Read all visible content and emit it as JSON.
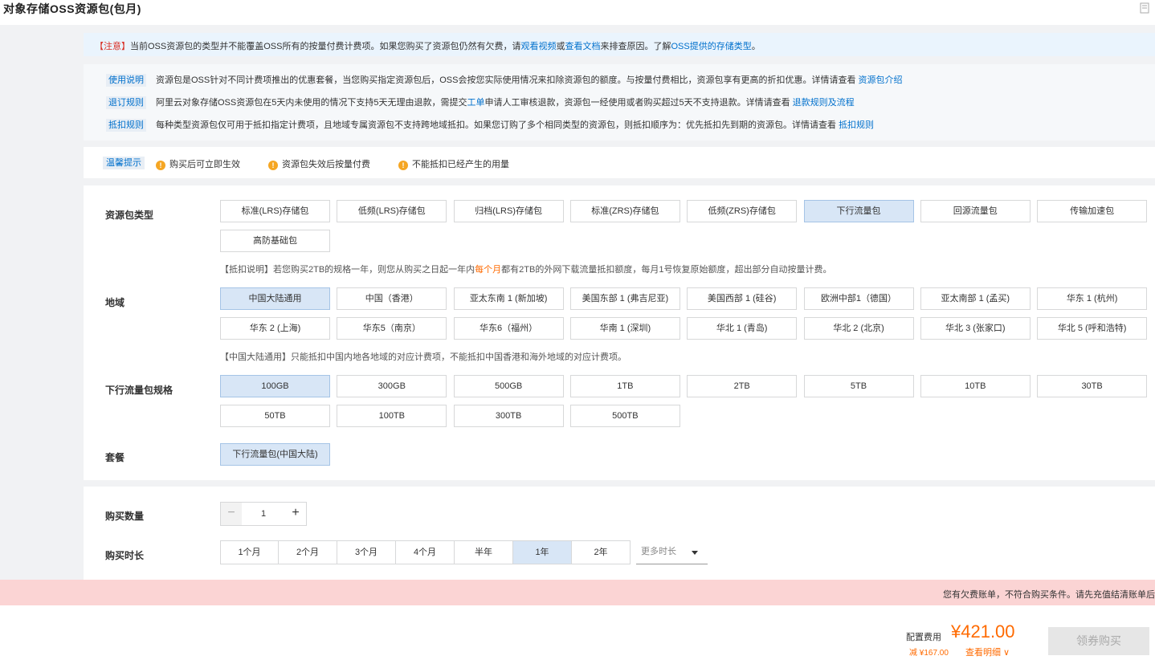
{
  "header": {
    "title": "对象存储OSS资源包(包月)"
  },
  "notice": {
    "tag": "【注意】",
    "text1": "当前OSS资源包的类型并不能覆盖OSS所有的按量付费计费项。如果您购买了资源包仍然有欠费，请",
    "link_video": "观看视频",
    "or": "或",
    "link_doc": "查看文档",
    "text2": "来排查原因。了解",
    "link_types": "OSS提供的存储类型",
    "end": "。"
  },
  "info": {
    "usage": {
      "label": "使用说明",
      "text": "资源包是OSS针对不同计费项推出的优惠套餐，当您购买指定资源包后，OSS会按您实际使用情况来扣除资源包的额度。与按量付费相比，资源包享有更高的折扣优惠。详情请查看 ",
      "link": "资源包介绍"
    },
    "refund": {
      "label": "退订规则",
      "text1": "阿里云对象存储OSS资源包在5天内未使用的情况下支持5天无理由退款，需提交",
      "link1": "工单",
      "text2": "申请人工审核退款，资源包一经使用或者购买超过5天不支持退款。详情请查看 ",
      "link2": "退款规则及流程"
    },
    "deduct": {
      "label": "抵扣规则",
      "text": "每种类型资源包仅可用于抵扣指定计费项，且地域专属资源包不支持跨地域抵扣。如果您订购了多个相同类型的资源包，则抵扣顺序为：优先抵扣先到期的资源包。详情请查看 ",
      "link": "抵扣规则"
    }
  },
  "tips": {
    "label": "温馨提示",
    "items": [
      "购买后可立即生效",
      "资源包失效后按量付费",
      "不能抵扣已经产生的用量"
    ]
  },
  "package_type": {
    "label": "资源包类型",
    "options": [
      "标准(LRS)存储包",
      "低频(LRS)存储包",
      "归档(LRS)存储包",
      "标准(ZRS)存储包",
      "低频(ZRS)存储包",
      "下行流量包",
      "回源流量包",
      "传输加速包",
      "高防基础包"
    ],
    "selected": 5,
    "note_pre": "【抵扣说明】若您购买2TB的规格一年，则您从购买之日起一年内",
    "note_hl": "每个月",
    "note_post": "都有2TB的外网下载流量抵扣额度，每月1号恢复原始额度，超出部分自动按量计费。"
  },
  "region": {
    "label": "地域",
    "options": [
      "中国大陆通用",
      "中国（香港）",
      "亚太东南 1 (新加坡)",
      "美国东部 1 (弗吉尼亚)",
      "美国西部 1 (硅谷)",
      "欧洲中部1（德国）",
      "亚太南部 1 (孟买)",
      "华东 1 (杭州)",
      "华东 2 (上海)",
      "华东5（南京）",
      "华东6（福州）",
      "华南 1 (深圳)",
      "华北 1 (青岛)",
      "华北 2 (北京)",
      "华北 3 (张家口)",
      "华北 5 (呼和浩特)"
    ],
    "selected": 0,
    "note": "【中国大陆通用】只能抵扣中国内地各地域的对应计费项，不能抵扣中国香港和海外地域的对应计费项。"
  },
  "spec": {
    "label": "下行流量包规格",
    "options": [
      "100GB",
      "300GB",
      "500GB",
      "1TB",
      "2TB",
      "5TB",
      "10TB",
      "30TB",
      "50TB",
      "100TB",
      "300TB",
      "500TB"
    ],
    "selected": 0
  },
  "plan": {
    "label": "套餐",
    "options": [
      "下行流量包(中国大陆)"
    ],
    "selected": 0
  },
  "quantity": {
    "label": "购买数量",
    "value": "1",
    "minus": "−",
    "plus": "+"
  },
  "duration": {
    "label": "购买时长",
    "options": [
      "1个月",
      "2个月",
      "3个月",
      "4个月",
      "半年",
      "1年",
      "2年"
    ],
    "selected": 5,
    "more": "更多时长"
  },
  "alert": {
    "text": "您有欠费账单，不符合购买条件。请先充值结清账单后"
  },
  "footer": {
    "fee_label": "配置费用",
    "price": "¥421.00",
    "discount": "减 ¥167.00",
    "detail": "查看明细 ∨",
    "buy": "领券购买"
  },
  "colors": {
    "accent": "#0070cc",
    "price": "#ff6a00",
    "selected_bg": "#d8e6f6",
    "alert_bg": "#fbd4d4"
  }
}
